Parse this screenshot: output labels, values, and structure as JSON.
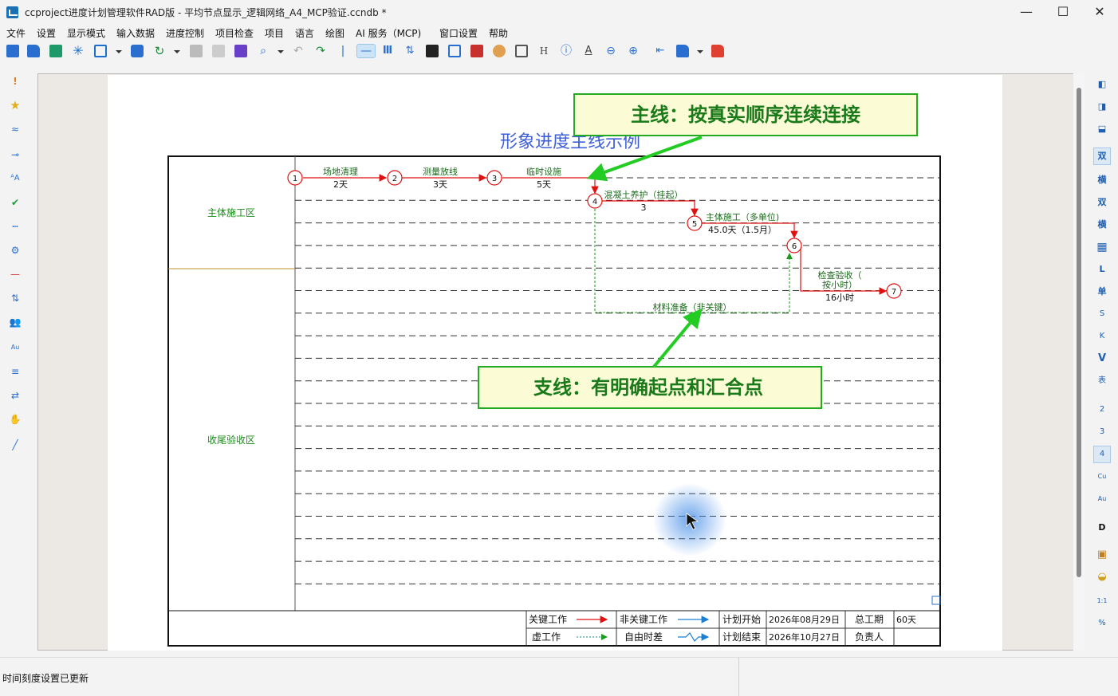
{
  "window": {
    "title": "ccproject进度计划管理软件RAD版 - 平均节点显示_逻辑网络_A4_MCP验证.ccndb *",
    "minimize": "—",
    "maximize": "☐",
    "close": "✕"
  },
  "menu": [
    "文件",
    "设置",
    "显示模式",
    "输入数据",
    "进度控制",
    "项目检查",
    "项目",
    "语言",
    "绘图",
    "AI 服务（MCP)",
    "窗口设置",
    "帮助"
  ],
  "toolbar": {
    "icons": [
      "new-file-icon",
      "open-folder-icon",
      "save-icon",
      "asterisk-icon",
      "export-image-icon",
      "print-icon",
      "refresh-icon",
      "copy-icon",
      "paste-icon",
      "format-brush-icon",
      "zoom-icon",
      "undo-icon",
      "redo-icon",
      "separator-icon",
      "horizontal-line-icon",
      "columns-icon",
      "sort-icon",
      "contrast-icon",
      "route-icon",
      "delete-doc-icon",
      "palette-icon",
      "edit-doc-icon",
      "h-text-icon",
      "info-icon",
      "font-icon",
      "zoom-out-icon",
      "zoom-in-icon",
      "double-arrow-icon",
      "folder-icon",
      "red-folder-icon"
    ]
  },
  "left_tools": [
    "exclamation-icon",
    "star-icon",
    "wave-icon",
    "key-icon",
    "font-size-icon",
    "check-icon",
    "dotted-line-icon",
    "gear-icon",
    "red-line-icon",
    "sort-icon",
    "users-icon",
    "text-au-icon",
    "filter-icon",
    "swap-icon",
    "hand-icon",
    "pen-icon"
  ],
  "right_tools": [
    "单列",
    "单列2",
    "单行",
    "双",
    "横",
    "双",
    "横",
    "表格",
    "L",
    "单",
    "S",
    "K",
    "V",
    "表",
    "2",
    "3",
    "4",
    "Cu",
    "Au",
    "D",
    "日历",
    "注",
    "1:1",
    "%"
  ],
  "diagram": {
    "title": "形象进度主线示例",
    "zones": [
      "主体施工区",
      "收尾验收区"
    ],
    "nodes": [
      "1",
      "2",
      "3",
      "4",
      "5",
      "6",
      "7"
    ],
    "tasks": [
      {
        "name": "场地清理",
        "duration": "2天"
      },
      {
        "name": "测量放线",
        "duration": "3天"
      },
      {
        "name": "临时设施",
        "duration": "5天"
      },
      {
        "name": "混凝土养护（挂起）",
        "duration": "3"
      },
      {
        "name": "主体施工（多单位)",
        "duration": "45.0天（1.5月）"
      },
      {
        "name_line1": "检查验收（",
        "name_line2": "按小时）",
        "duration": "16小时"
      },
      {
        "name": "材料准备（非关键）",
        "duration": ""
      }
    ],
    "callout_main": "主线：按真实顺序连续连接",
    "callout_branch": "支线：有明确起点和汇合点",
    "legend": {
      "critical": "关键工作",
      "noncritical": "非关键工作",
      "dummy": "虚工作",
      "float": "自由时差",
      "plan_start_label": "计划开始",
      "plan_start": "2026年08月29日",
      "plan_end_label": "计划结束",
      "plan_end": "2026年10月27日",
      "total_label": "总工期",
      "total": "60天",
      "owner_label": "负责人",
      "owner": ""
    },
    "colors": {
      "critical": "#e01010",
      "noncritical": "#1a7fd0",
      "dummy": "#1a9a1a",
      "zone_text": "#1a8a1a",
      "title": "#3f5fd8",
      "callout_fill": "#fbfbd5",
      "callout_border": "#22aa22"
    }
  },
  "status": {
    "message": "时间刻度设置已更新"
  }
}
